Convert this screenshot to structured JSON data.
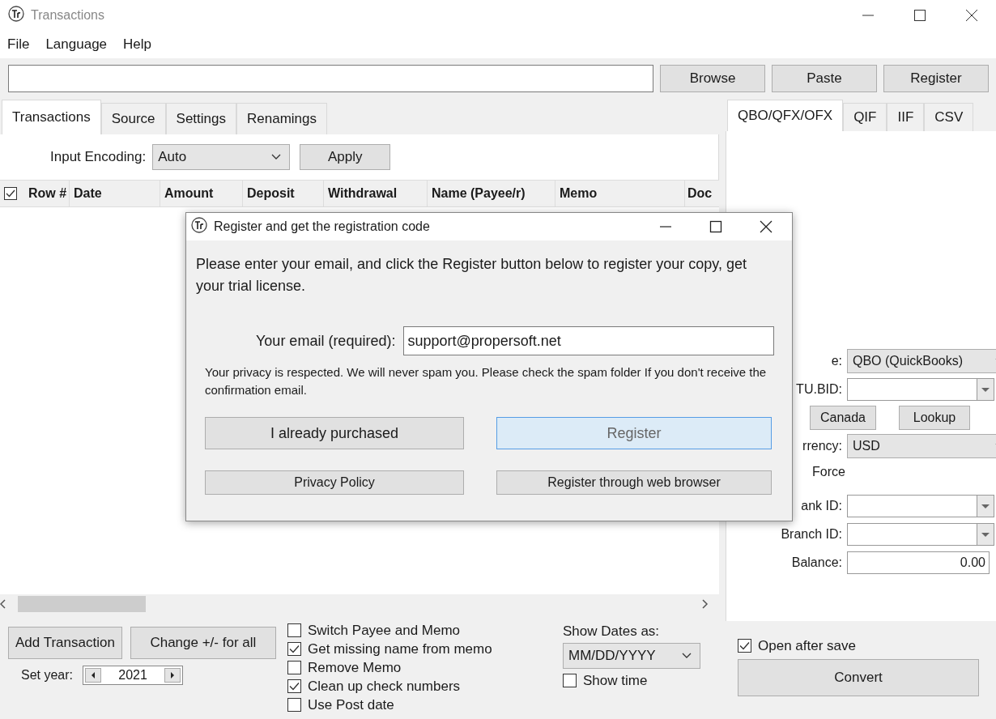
{
  "window": {
    "title": "Transactions"
  },
  "menu": [
    "File",
    "Language",
    "Help"
  ],
  "toolbar_buttons": [
    "Browse",
    "Paste",
    "Register"
  ],
  "tabs": [
    {
      "label": "Transactions",
      "selected": true
    },
    {
      "label": "Source",
      "selected": false
    },
    {
      "label": "Settings",
      "selected": false
    },
    {
      "label": "Renamings",
      "selected": false
    }
  ],
  "encoding": {
    "label": "Input Encoding:",
    "value": "Auto",
    "button": "Apply"
  },
  "table": {
    "select_all_checked": true,
    "columns": [
      "Row #",
      "Date",
      "Amount",
      "Deposit",
      "Withdrawal",
      "Name (Payee/r)",
      "Memo",
      "Doc"
    ]
  },
  "bottom": {
    "buttons": [
      "Add Transaction",
      "Change +/- for all"
    ],
    "year_label": "Set year:",
    "year": "2021",
    "options": [
      {
        "label": "Switch Payee and Memo",
        "checked": false
      },
      {
        "label": "Get missing name from memo",
        "checked": true
      },
      {
        "label": "Remove Memo",
        "checked": false
      },
      {
        "label": "Clean up check numbers",
        "checked": true
      },
      {
        "label": "Use Post date",
        "checked": false
      }
    ],
    "dates_label": "Show Dates as:",
    "date_format": "MM/DD/YYYY",
    "show_time": {
      "label": "Show time",
      "checked": false
    }
  },
  "right": {
    "tabs": [
      {
        "label": "QBO/QFX/OFX",
        "selected": true
      },
      {
        "label": "QIF",
        "selected": false
      },
      {
        "label": "IIF",
        "selected": false
      },
      {
        "label": "CSV",
        "selected": false
      }
    ],
    "fields": [
      {
        "kind": "select",
        "label": "e:",
        "value": "QBO (QuickBooks)"
      },
      {
        "kind": "combo",
        "label": "TU.BID:"
      },
      {
        "kind": "buttons",
        "buttons": [
          "Canada",
          "Lookup"
        ]
      },
      {
        "kind": "select",
        "label": "rrency:",
        "value": "USD"
      },
      {
        "kind": "text",
        "label": "Force"
      },
      {
        "kind": "combo",
        "label": "ank ID:"
      },
      {
        "kind": "combo",
        "label": "Branch ID:"
      },
      {
        "kind": "input",
        "label": "Balance:",
        "value": "0.00"
      }
    ],
    "open_after_save": {
      "label": "Open after save",
      "checked": true
    },
    "convert": "Convert"
  },
  "dialog": {
    "title": "Register and get the registration code",
    "message": "Please enter your email, and click the Register button below to register your copy, get your trial license.",
    "email_label": "Your email (required):",
    "email_value": "support@propersoft.net",
    "privacy_note": "Your privacy is respected. We will never spam you. Please check the spam folder If you don't receive the confirmation email.",
    "buttons": [
      {
        "label": "I already purchased",
        "highlighted": false
      },
      {
        "label": "Register",
        "highlighted": true
      },
      {
        "label": "Privacy Policy",
        "highlighted": false
      },
      {
        "label": "Register through web browser",
        "highlighted": false
      }
    ]
  }
}
